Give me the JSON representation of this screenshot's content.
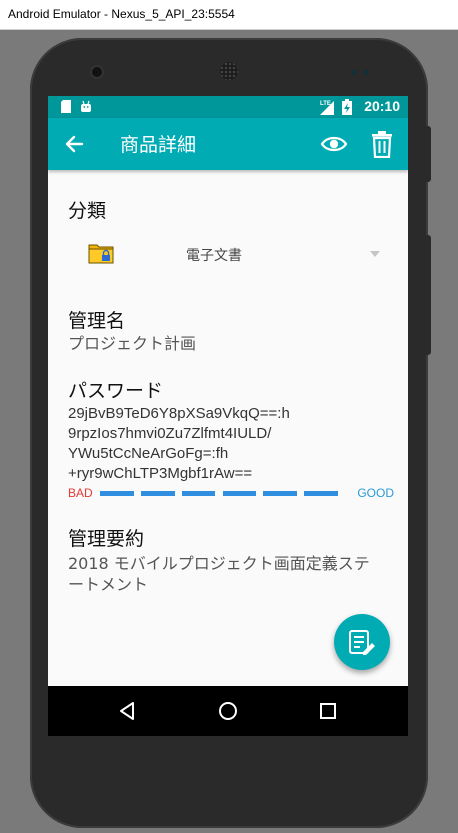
{
  "window": {
    "title": "Android Emulator - Nexus_5_API_23:5554"
  },
  "status_bar": {
    "time": "20:10",
    "network": "LTE"
  },
  "app_bar": {
    "title": "商品詳細",
    "back_icon": "arrow-back-icon",
    "actions": [
      "eye-icon",
      "trash-icon"
    ]
  },
  "category": {
    "label": "分類",
    "selected": "電子文書",
    "icon": "locked-folder-icon"
  },
  "management_name": {
    "label": "管理名",
    "value": "プロジェクト計画"
  },
  "password": {
    "label": "パスワード",
    "lines": [
      "29jBvB9TeD6Y8pXSa9VkqQ==:h",
      "9rpzIos7hmvi0Zu7Zlfmt4IULD/",
      "YWu5tCcNeArGoFg=:fh",
      "+ryr9wChLTP3Mgbf1rAw=="
    ],
    "strength": {
      "bad_label": "BAD",
      "good_label": "GOOD",
      "level": 1.0,
      "segments": 6
    }
  },
  "summary": {
    "label": "管理要約",
    "lines": [
      "2018 モバイルプロジェクト画面定義ステ",
      "ートメント"
    ]
  },
  "fab": {
    "icon": "edit-note-icon"
  },
  "nav_bar": {
    "buttons": [
      "back-triangle-icon",
      "home-circle-icon",
      "recents-square-icon"
    ]
  },
  "colors": {
    "status_bar": "#00979a",
    "app_bar": "#00abb4",
    "bad": "#e53935",
    "good": "#2a9bd6",
    "meter": "#2f8ee0"
  }
}
